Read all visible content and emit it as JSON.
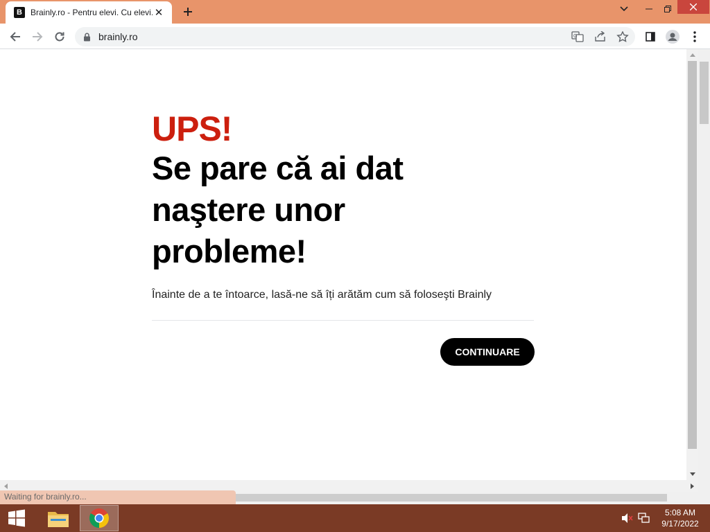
{
  "browser": {
    "tab": {
      "favicon_letter": "B",
      "title": "Brainly.ro - Pentru elevi. Cu elevi."
    },
    "address": {
      "url": "brainly.ro"
    },
    "status_text": "Waiting for brainly.ro..."
  },
  "page": {
    "ups": "UPS!",
    "headline_lines": [
      "Se pare că ai dat",
      "naştere unor",
      "probleme!"
    ],
    "subtext": "Înainte de a te întoarce, lasă-ne să îți arătăm cum să foloseşti Brainly",
    "continue_label": "CONTINUARE"
  },
  "taskbar": {
    "time": "5:08 AM",
    "date": "9/17/2022"
  },
  "colors": {
    "accent_red": "#cc1f0e",
    "titlebar": "#e8946a",
    "taskbar": "#7a3a25"
  }
}
